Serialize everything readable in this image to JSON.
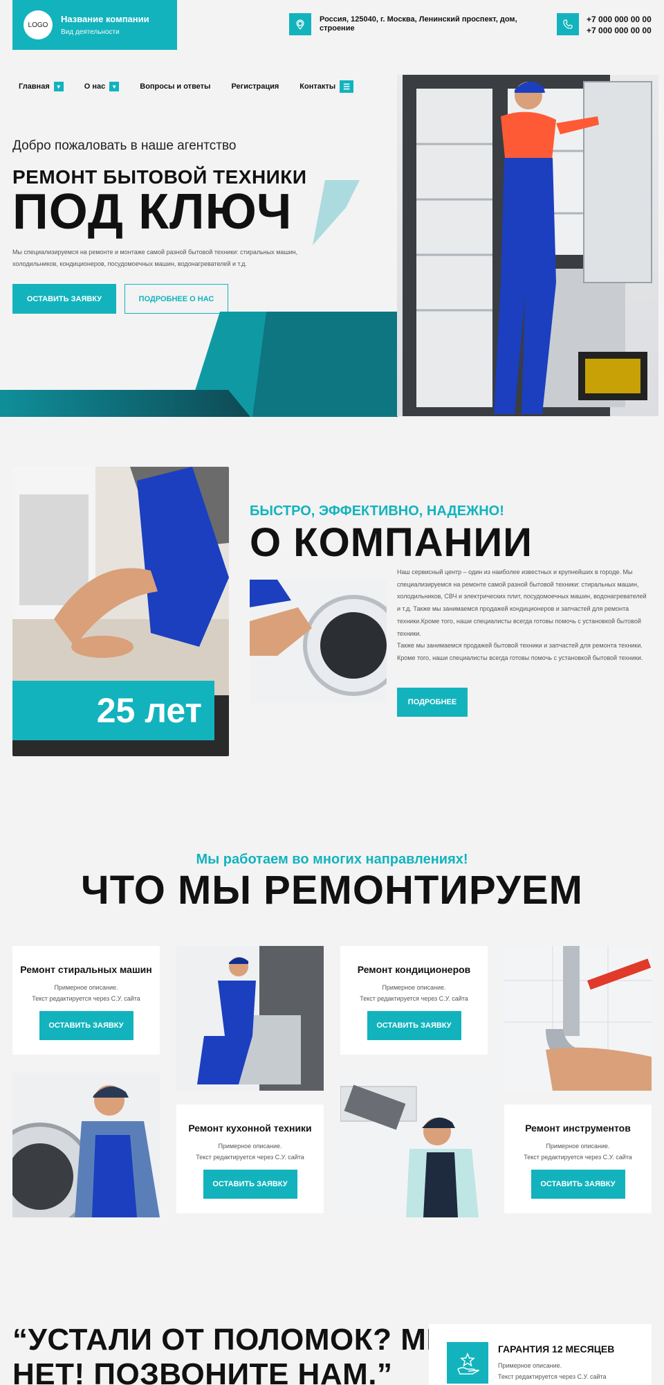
{
  "header": {
    "logo_text": "LOGO",
    "company_name": "Название компании",
    "company_activity": "Вид деятельности",
    "address_line1": "Россия, 125040, г. Москва, Ленинский проспект, дом,",
    "address_line2": "строение",
    "phone1": "+7 000 000 00 00",
    "phone2": "+7 000 000 00 00"
  },
  "nav": {
    "items": [
      {
        "label": "Главная",
        "dropdown": true
      },
      {
        "label": "О нас",
        "dropdown": true
      },
      {
        "label": "Вопросы и ответы",
        "dropdown": false
      },
      {
        "label": "Регистрация",
        "dropdown": false
      },
      {
        "label": "Контакты",
        "dropdown": false
      }
    ]
  },
  "hero": {
    "welcome": "Добро пожаловать в наше агентство",
    "title_line1": "РЕМОНТ БЫТОВОЙ ТЕХНИКИ",
    "title_line2": "ПОД КЛЮЧ",
    "description": "Мы специализируемся на ремонте и монтаже самой разной бытовой техники: стиральных машин, холодильников, кондиционеров, посудомоечных машин, водонагревателей и т.д.",
    "btn_primary": "ОСТАВИТЬ ЗАЯВКУ",
    "btn_secondary": "ПОДРОБНЕЕ О НАС"
  },
  "about": {
    "years": "25 лет",
    "subtitle": "БЫСТРО, ЭФФЕКТИВНО, НАДЕЖНО!",
    "title": "О КОМПАНИИ",
    "text1": "Наш сервисный центр – один из наиболее известных и крупнейших в городе. Мы специализируемся на ремонте самой разной бытовой техники: стиральных машин, холодильников, СВЧ и электрических плит, посудомоечных машин, водонагревателей и т.д. Также мы занимаемся продажей кондиционеров и запчастей для ремонта техники.Кроме того, наши специалисты всегда готовы помочь с установкой бытовой техники.",
    "text2": "Также мы занимаемся продажей бытовой техники и запчастей для ремонта техники. Кроме того, наши специалисты всегда готовы помочь с установкой бытовой техники.",
    "btn": "ПОДРОБНЕЕ"
  },
  "services": {
    "subtitle": "Мы работаем во многих направлениях!",
    "title": "ЧТО МЫ РЕМОНТИРУЕМ",
    "desc1": "Примерное описание.",
    "desc2": "Текст редактируется через С.У. сайта",
    "btn": "ОСТАВИТЬ ЗАЯВКУ",
    "cards": [
      {
        "title": "Ремонт стиральных машин"
      },
      {
        "title": "Ремонт кондиционеров"
      },
      {
        "title": "Ремонт кухонной техники"
      },
      {
        "title": "Ремонт инструментов"
      }
    ]
  },
  "bottom": {
    "quote_line1": "“УСТАЛИ ОТ ПОЛОМОК? МЫ –",
    "quote_line2": "НЕТ! ПОЗВОНИТЕ НАМ.”",
    "guarantee_title": "ГАРАНТИЯ 12 МЕСЯЦЕВ",
    "guarantee_text1": "Примерное описание.",
    "guarantee_text2": "Текст редактируется через С.У. сайта"
  },
  "colors": {
    "accent": "#12b3bd",
    "dark_teal": "#0e5a66",
    "background": "#f3f3f3"
  }
}
